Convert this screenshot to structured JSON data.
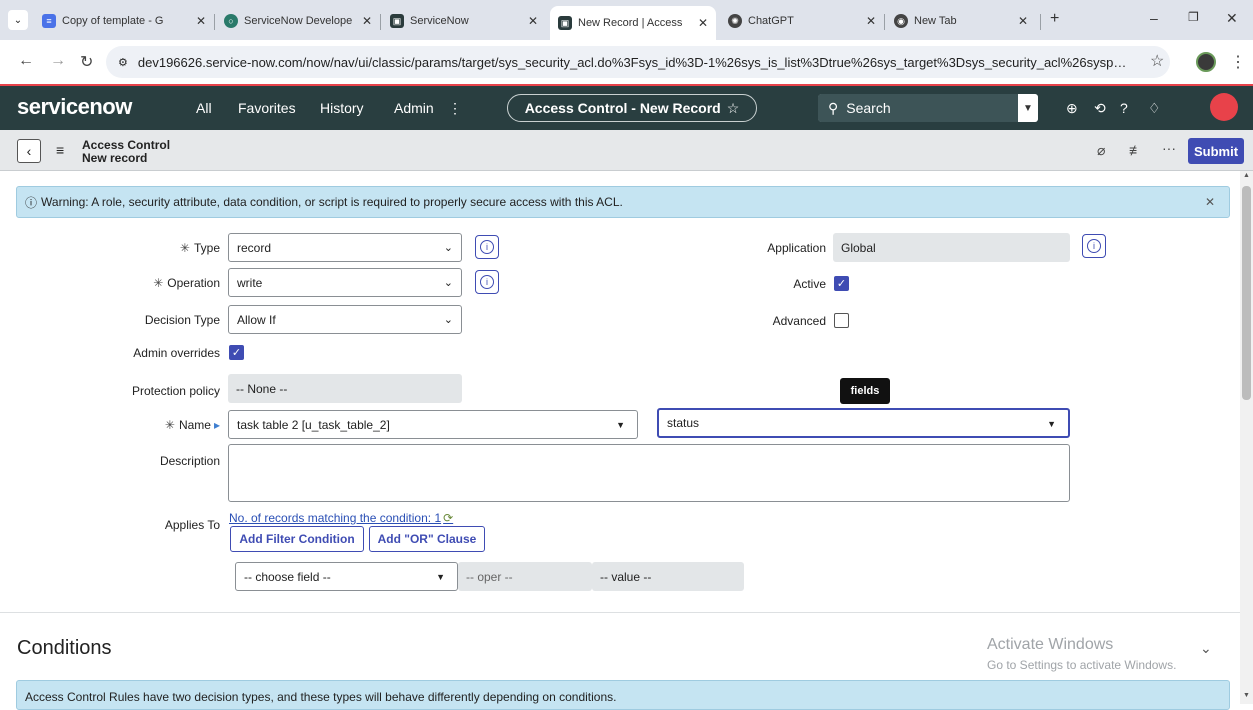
{
  "tabs": [
    {
      "title": "Copy of template - G",
      "icon_color": "#4a72e8"
    },
    {
      "title": "ServiceNow Develope",
      "icon_color": "#2a7a6a"
    },
    {
      "title": "ServiceNow",
      "icon_color": "#2a3b3c"
    },
    {
      "title": "New Record | Access",
      "icon_color": "#2a3b3c"
    },
    {
      "title": "ChatGPT",
      "icon_color": "#444"
    },
    {
      "title": "New Tab",
      "icon_color": "#444"
    }
  ],
  "address": {
    "url": "dev196626.service-now.com/now/nav/ui/classic/params/target/sys_security_acl.do%3Fsys_id%3D-1%26sys_is_list%3Dtrue%26sys_target%3Dsys_security_acl%26sysparm_che..."
  },
  "header": {
    "logo": "servicenow",
    "nav": [
      "All",
      "Favorites",
      "History",
      "Admin"
    ],
    "title_pill": "Access Control - New Record",
    "search_label": "Search"
  },
  "form_header": {
    "title": "Access Control",
    "subtitle": "New record",
    "submit_label": "Submit"
  },
  "warning": "Warning: A role, security attribute, data condition, or script is required to properly secure access with this ACL.",
  "fields": {
    "type_label": "Type",
    "type_value": "record",
    "operation_label": "Operation",
    "operation_value": "write",
    "decision_type_label": "Decision Type",
    "decision_type_value": "Allow If",
    "admin_overrides_label": "Admin overrides",
    "admin_overrides_checked": true,
    "protection_policy_label": "Protection policy",
    "protection_policy_value": "-- None --",
    "name_label": "Name",
    "name_table_value": "task table 2 [u_task_table_2]",
    "name_field_value": "status",
    "description_label": "Description",
    "applies_to_label": "Applies To",
    "records_link": "No. of records matching the condition: 1",
    "add_filter_label": "Add Filter Condition",
    "add_or_label": "Add \"OR\" Clause",
    "choose_field": "-- choose field --",
    "oper": "-- oper --",
    "value": "-- value --",
    "application_label": "Application",
    "application_value": "Global",
    "active_label": "Active",
    "active_checked": true,
    "advanced_label": "Advanced",
    "advanced_checked": false
  },
  "tooltip": "fields",
  "conditions": {
    "title": "Conditions",
    "info": "Access Control Rules have two decision types, and these types will behave differently depending on conditions."
  },
  "watermark": {
    "line1": "Activate Windows",
    "line2": "Go to Settings to activate Windows."
  },
  "colors": {
    "sn_header": "#293e40",
    "accent": "#3f4cb3",
    "info_bar": "#c5e4f2"
  }
}
